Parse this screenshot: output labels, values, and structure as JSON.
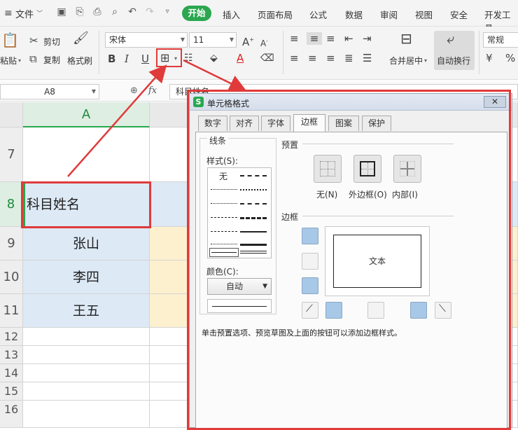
{
  "menubar": {
    "file": "文件",
    "tabs": [
      "开始",
      "插入",
      "页面布局",
      "公式",
      "数据",
      "审阅",
      "视图",
      "安全",
      "开发工具"
    ]
  },
  "ribbon": {
    "paste": "粘贴",
    "cut": "剪切",
    "copy": "复制",
    "format_painter": "格式刷",
    "font_name": "宋体",
    "font_size": "11",
    "merge_center": "合并居中",
    "wrap_text": "自动换行",
    "number_format": "常规"
  },
  "formula_bar": {
    "cell_ref": "A8",
    "fx": "fx",
    "content": "科目姓名"
  },
  "grid": {
    "column_a": "A",
    "rows": [
      {
        "num": "7",
        "a": ""
      },
      {
        "num": "8",
        "a": "科目姓名"
      },
      {
        "num": "9",
        "a": "张山"
      },
      {
        "num": "10",
        "a": "李四"
      },
      {
        "num": "11",
        "a": "王五"
      },
      {
        "num": "12",
        "a": ""
      },
      {
        "num": "13",
        "a": ""
      },
      {
        "num": "14",
        "a": ""
      },
      {
        "num": "15",
        "a": ""
      },
      {
        "num": "16",
        "a": ""
      }
    ]
  },
  "dialog": {
    "title": "单元格格式",
    "tabs": [
      "数字",
      "对齐",
      "字体",
      "边框",
      "图案",
      "保护"
    ],
    "line_group": "线条",
    "style_label": "样式(S):",
    "style_none": "无",
    "color_label": "颜色(C):",
    "color_value": "自动",
    "preset_group": "预置",
    "preset_none": "无(N)",
    "preset_outline": "外边框(O)",
    "preset_inside": "内部(I)",
    "border_group": "边框",
    "preview_text": "文本",
    "hint": "单击预置选项、预览草图及上面的按钮可以添加边框样式。"
  },
  "colors": {
    "accent_green": "#2aa74f",
    "annotation_red": "#e03a3a",
    "selected_cell_fill": "#dde9f5",
    "row_fill_blue": "#dde9f5",
    "row_fill_yellow": "#fdf0cf"
  }
}
